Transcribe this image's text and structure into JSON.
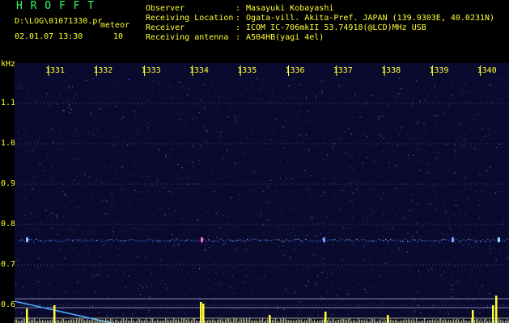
{
  "header": {
    "title": "H R O F F T",
    "file_path": "D:\\LOG\\01071330.pr",
    "mode": "meteor",
    "datetime": "02.01.07 13:30",
    "count": "10",
    "fields": [
      {
        "label": "Observer",
        "value": "Masayuki Kobayashi"
      },
      {
        "label": "Receiving Location",
        "value": "Ogata-vill. Akita-Pref. JAPAN (139.9303E, 40.0231N)"
      },
      {
        "label": "Receiver",
        "value": "ICOM IC-706mkII 53.74918(@LCD)MHz USB"
      },
      {
        "label": "Receiving antenna",
        "value": "A504HB(yagi 4el)"
      }
    ]
  },
  "spectrogram": {
    "y_unit": "kHz",
    "y_ticks": [
      "1.1",
      "1.0",
      "0.9",
      "0.8",
      "0.7",
      "0.6"
    ],
    "x_ticks": [
      "1331",
      "1332",
      "1333",
      "1334",
      "1335",
      "1336",
      "1337",
      "1338",
      "1339",
      "1340"
    ],
    "colors": {
      "background": "#0a0a2e",
      "grid": "#6a7fa0",
      "label": "#ffff33",
      "trace": "#4aa8ff"
    }
  }
}
